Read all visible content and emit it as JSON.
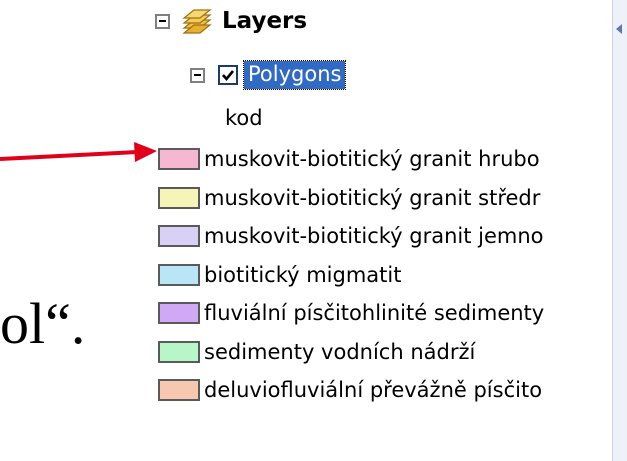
{
  "slide": {
    "text_fragment": "ol“."
  },
  "toc": {
    "root": {
      "label": "Layers",
      "icon": "layers-icon",
      "toggle": "collapse-icon"
    },
    "layer": {
      "label": "Polygons",
      "checked": true,
      "selected": true,
      "toggle": "collapse-icon"
    },
    "field_heading": "kod",
    "legend": [
      {
        "label": "muskovit-biotitický granit hrubo",
        "color": "#f5b8d0"
      },
      {
        "label": "muskovit-biotitický granit středr",
        "color": "#f5f5b8"
      },
      {
        "label": "muskovit-biotitický granit jemno",
        "color": "#d8d0f5"
      },
      {
        "label": "biotitický migmatit",
        "color": "#b8e6f7"
      },
      {
        "label": "fluviální písčitohlinité sedimenty",
        "color": "#d0a8f5"
      },
      {
        "label": "sedimenty vodních nádrží",
        "color": "#b8f5c8"
      },
      {
        "label": "deluviofluviální převážně písčito",
        "color": "#f7c8b0"
      }
    ]
  },
  "annotation": {
    "arrow_color": "#e0001a"
  },
  "scrollbar": {
    "arrow_icon": "scroll-left-icon"
  }
}
